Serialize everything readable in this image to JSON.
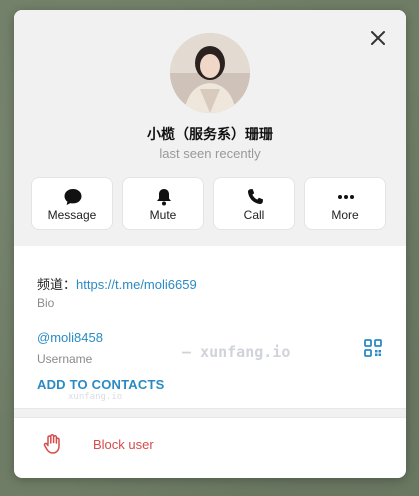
{
  "watermark": "xunfang.io",
  "profile": {
    "name": "小榄（服务系）珊珊",
    "status": "last seen recently"
  },
  "actions": [
    {
      "label": "Message",
      "icon": "message-icon"
    },
    {
      "label": "Mute",
      "icon": "bell-icon"
    },
    {
      "label": "Call",
      "icon": "phone-icon"
    },
    {
      "label": "More",
      "icon": "more-dots-icon"
    }
  ],
  "bio": {
    "prefix": "频道：",
    "link": "https://t.me/moli6659",
    "label": "Bio"
  },
  "username": {
    "value": "@moli8458",
    "label": "Username"
  },
  "add_contacts": "ADD TO CONTACTS",
  "block": {
    "label": "Block user",
    "icon": "hand-icon"
  },
  "colors": {
    "accent": "#2a8bc4",
    "danger": "#d54b4b",
    "muted": "#8b8b8b"
  }
}
